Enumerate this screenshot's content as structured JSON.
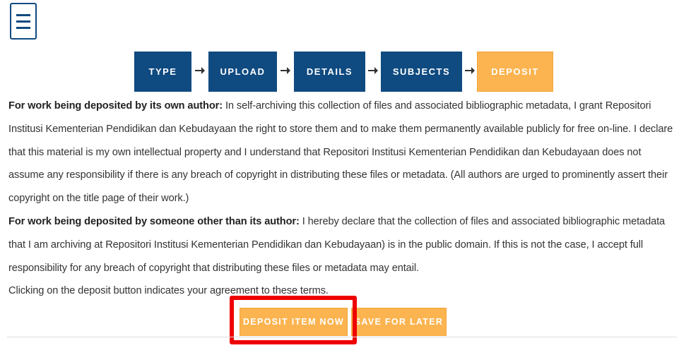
{
  "menu": {
    "icon": "hamburger-menu-icon"
  },
  "workflow": {
    "steps": [
      {
        "label": "TYPE",
        "active": false
      },
      {
        "label": "UPLOAD",
        "active": false
      },
      {
        "label": "DETAILS",
        "active": false
      },
      {
        "label": "SUBJECTS",
        "active": false
      },
      {
        "label": "DEPOSIT",
        "active": true
      }
    ],
    "arrow_icon": "arrow-right-icon",
    "colors": {
      "step": "#0f4a80",
      "active_step": "#fbb450"
    }
  },
  "terms": {
    "own_author_heading": "For work being deposited by its own author:",
    "own_author_text": " In self-archiving this collection of files and associated bibliographic metadata, I grant Repositori Institusi Kementerian Pendidikan dan Kebudayaan the right to store them and to make them permanently available publicly for free on-line. I declare that this material is my own intellectual property and I understand that Repositori Institusi Kementerian Pendidikan dan Kebudayaan does not assume any responsibility if there is any breach of copyright in distributing these files or metadata. (All authors are urged to prominently assert their copyright on the title page of their work.)",
    "other_author_heading": "For work being deposited by someone other than its author:",
    "other_author_text": " I hereby declare that the collection of files and associated bibliographic metadata that I am archiving at Repositori Institusi Kementerian Pendidikan dan Kebudayaan) is in the public domain. If this is not the case, I accept full responsibility for any breach of copyright that distributing these files or metadata may entail.",
    "agreement_text": "Clicking on the deposit button indicates your agreement to these terms."
  },
  "actions": {
    "deposit_label": "DEPOSIT ITEM NOW",
    "save_label": "SAVE FOR LATER",
    "highlight_color": "#ee0000"
  }
}
